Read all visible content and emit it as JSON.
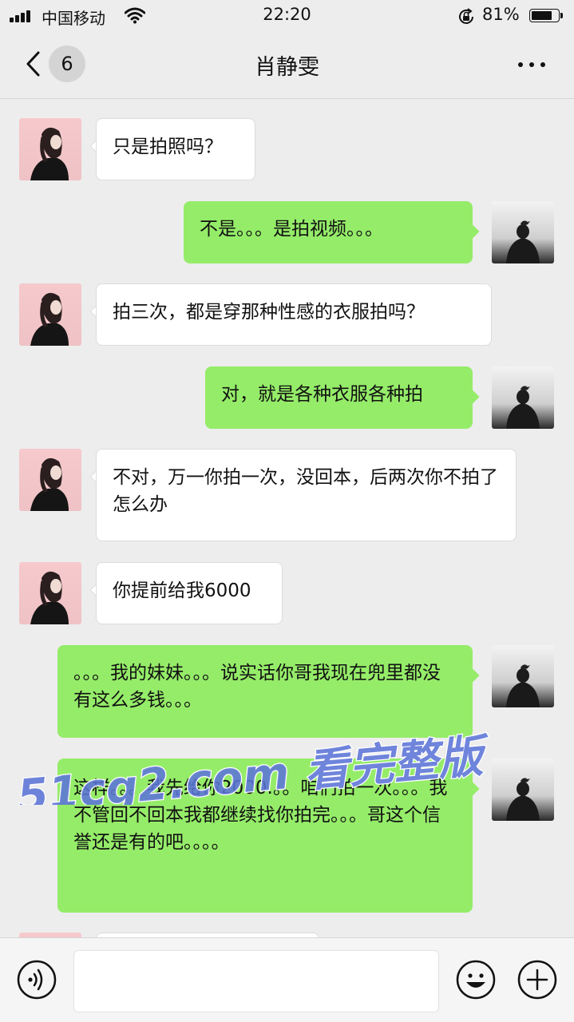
{
  "status_bar": {
    "carrier": "中国移动",
    "time": "22:20",
    "battery_percent": "81%",
    "battery_level": 0.81
  },
  "nav": {
    "unread_count": "6",
    "title": "肖静雯"
  },
  "messages": [
    {
      "side": "in",
      "text": "只是拍照吗？"
    },
    {
      "side": "out",
      "text": "不是。。。是拍视频。。。"
    },
    {
      "side": "in",
      "text": "拍三次，都是穿那种性感的衣服拍吗？"
    },
    {
      "side": "out",
      "text": "对，就是各种衣服各种拍"
    },
    {
      "side": "in",
      "text": "不对，万一你拍一次，没回本，后两次你不拍了怎么办"
    },
    {
      "side": "in",
      "text": "你提前给我6000"
    },
    {
      "side": "out",
      "text": "。。。我的妹妹。。。说实话你哥我现在兜里都没有这么多钱。。。"
    },
    {
      "side": "out",
      "text": "这样。。。我先给你2000.。。咱们拍一次。。。我不管回不回本我都继续找你拍完。。。哥这个信誉还是有的吧。。。。"
    }
  ],
  "watermark": {
    "text": "51cg2.com 看完整版"
  },
  "colors": {
    "outgoing_bubble": "#95ec69",
    "incoming_bubble": "#ffffff",
    "background": "#ededed"
  },
  "input_bar": {
    "voice_icon": "voice-icon",
    "emoji_icon": "emoji-icon",
    "add_icon": "add-icon"
  }
}
